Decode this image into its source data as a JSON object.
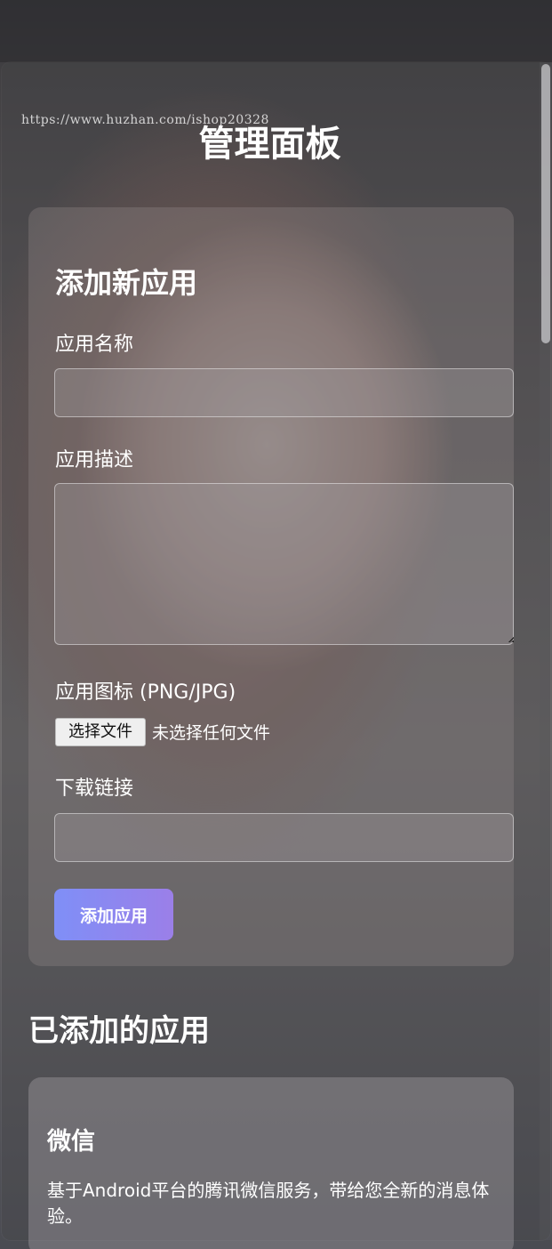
{
  "watermark": "https://www.huzhan.com/ishop20328",
  "page_title": "管理面板",
  "add_form": {
    "title": "添加新应用",
    "name_label": "应用名称",
    "name_value": "",
    "description_label": "应用描述",
    "description_value": "",
    "icon_label": "应用图标 (PNG/JPG)",
    "file_button_label": "选择文件",
    "file_status": "未选择任何文件",
    "download_label": "下载链接",
    "download_value": "",
    "submit_label": "添加应用",
    "button_gradient": [
      "#7f8ff7",
      "#9b7fe8"
    ]
  },
  "apps_section": {
    "title": "已添加的应用",
    "apps": [
      {
        "name": "微信",
        "description": "基于Android平台的腾讯微信服务，带给您全新的消息体验。"
      }
    ]
  }
}
